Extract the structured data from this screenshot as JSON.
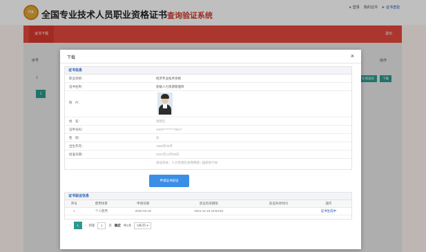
{
  "header": {
    "logo_text": "ITA",
    "title_main": "全国专业技术人员职业资格证书",
    "title_sub": "查询验证系统",
    "user_label": "登录",
    "link_2": "我的证书",
    "link_3": "证书查验"
  },
  "nav": {
    "active_tab": "证书下载",
    "right_link": "退出"
  },
  "background_table": {
    "col_index": "序号",
    "col_operation": "操作",
    "row_1_index": "1",
    "button_1": "在线查验",
    "button_2": "下载",
    "page": "1"
  },
  "modal": {
    "title": "下载",
    "close_label": "×",
    "cert_info": {
      "heading": "证书信息",
      "rows": [
        {
          "key": "职业资格：",
          "value": "经济专业技术资格"
        },
        {
          "key": "证书名称：",
          "value": "初级人力资源管理师"
        }
      ],
      "photo_label": "照　片：",
      "rows2": [
        {
          "key": "姓　名：",
          "value": "张晓红"
        },
        {
          "key": "证件号码：",
          "value": "4403**********8917"
        },
        {
          "key": "性　别：",
          "value": "女"
        },
        {
          "key": "出生年月：",
          "value": "1988年09月"
        },
        {
          "key": "批准日期：",
          "value": "2021年12月08日"
        }
      ],
      "extra_value": "发证机关：人力资源社会保障部 / 国家统计局",
      "verify_button": "申请证书验证"
    },
    "record": {
      "heading": "证书验证信息",
      "columns": [
        "序号",
        "使用场景",
        "申请日期",
        "验证有效期限",
        "验证失效时间",
        "操作"
      ],
      "rows": [
        {
          "index": "1",
          "scene": "个人使用",
          "date": "2022-03-19",
          "valid_until": "2021-12-18 18:53:53",
          "expire": "",
          "op": "证书生成中"
        }
      ]
    },
    "pager": {
      "prev": "‹",
      "current": "1",
      "next": "›",
      "goto_label": "到第",
      "goto_value": "1",
      "page_unit": "页",
      "confirm": "确定",
      "total": "共1条",
      "per_page": "5条/页"
    }
  },
  "colors": {
    "nav_red": "#e4493d",
    "teal": "#2b9a8c",
    "blue_button": "#3a8ee6",
    "link_blue": "#1e56b8"
  }
}
